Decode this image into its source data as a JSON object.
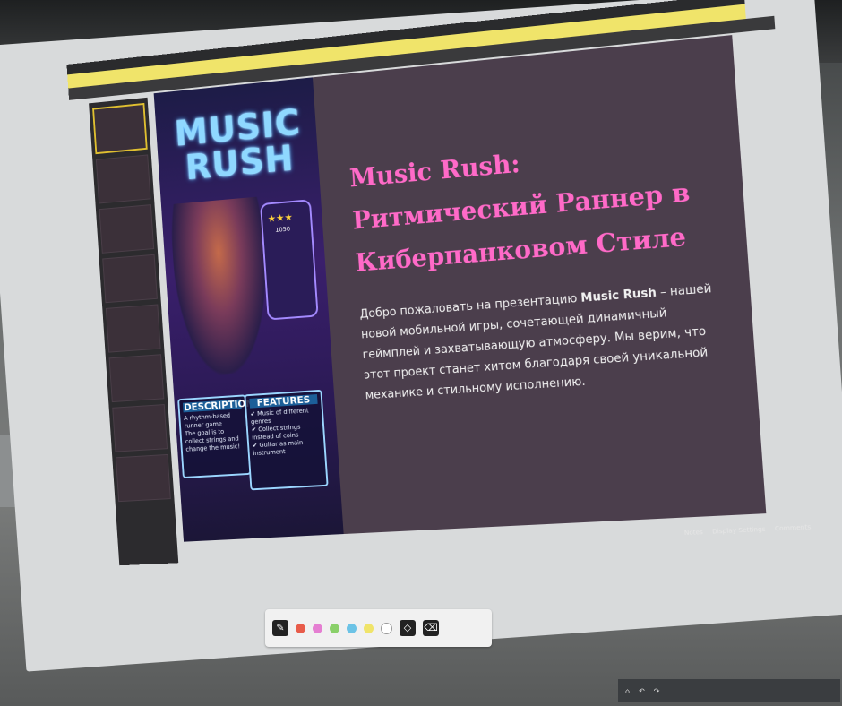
{
  "slide": {
    "heading": "Music Rush: Ритмический Раннер в Киберпанковом Стиле",
    "intro_before": "Добро пожаловать на презентацию ",
    "intro_bold": "Music Rush",
    "intro_after": " – нашей новой мобильной игры, сочетающей динамичный геймплей и захватывающую атмосферу. Мы верим, что этот проект станет хитом благодаря своей уникальной механике и стильному исполнению."
  },
  "poster": {
    "logo_line1": "MUSIC",
    "logo_line2": "RUSH",
    "phone_stars": "★★★",
    "phone_score": "1050",
    "description": {
      "title": "DESCRIPTION",
      "line1": "A rhythm-based runner game",
      "line2": "The goal is to collect strings and change the music!"
    },
    "features": {
      "title": "FEATURES",
      "items": [
        "Music of different genres",
        "Collect strings instead of coins",
        "Guitar as main instrument"
      ]
    }
  },
  "status_bar": {
    "notes": "Notes",
    "display_settings": "Display Settings",
    "comments": "Comments"
  },
  "colors": {
    "heading": "#ff6ac8",
    "slide_bg": "#4b3e4c",
    "yellow_bar": "#f0e46a"
  },
  "icons": [
    "pen-icon",
    "eraser-icon",
    "undo-icon",
    "redo-icon",
    "trash-icon",
    "home-icon"
  ]
}
